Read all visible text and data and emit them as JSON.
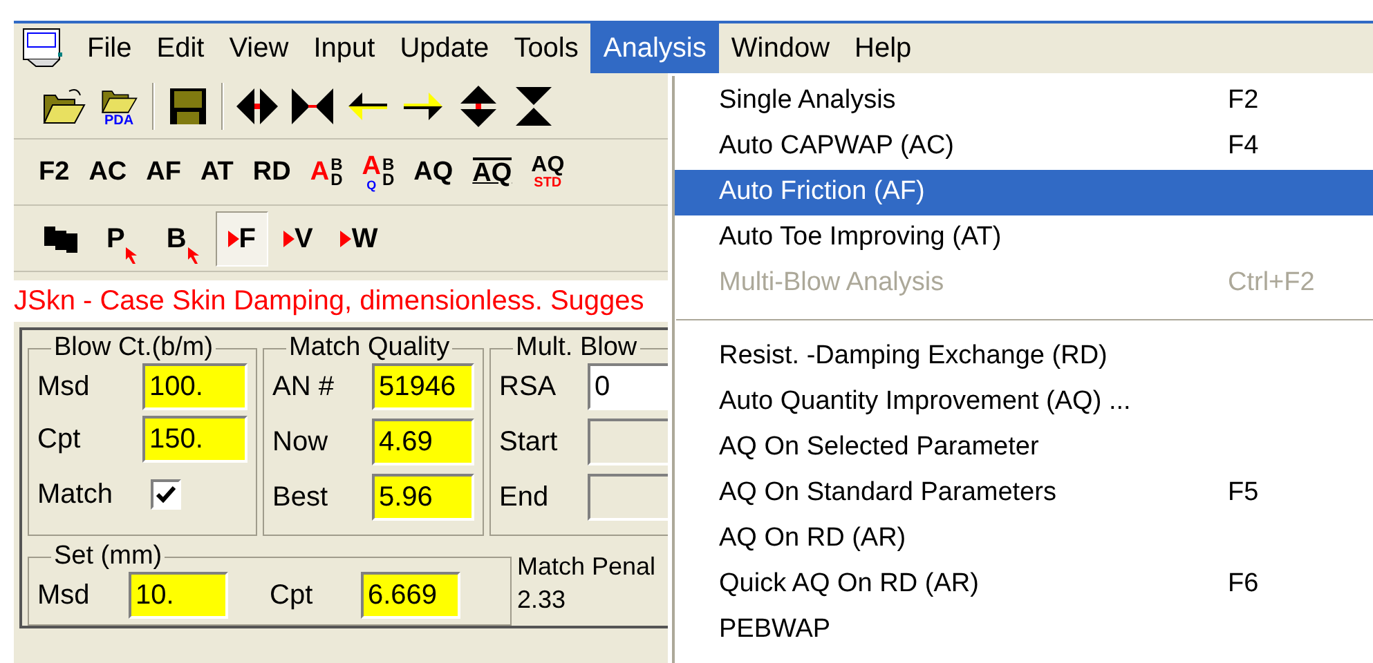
{
  "menu_bar": [
    {
      "label": "File",
      "selected": false
    },
    {
      "label": "Edit",
      "selected": false
    },
    {
      "label": "View",
      "selected": false
    },
    {
      "label": "Input",
      "selected": false
    },
    {
      "label": "Update",
      "selected": false
    },
    {
      "label": "Tools",
      "selected": false
    },
    {
      "label": "Analysis",
      "selected": true
    },
    {
      "label": "Window",
      "selected": false
    },
    {
      "label": "Help",
      "selected": false
    }
  ],
  "toolbar_1": [
    {
      "kind": "open"
    },
    {
      "kind": "open_pda",
      "label": "PDA"
    },
    {
      "kind": "sep"
    },
    {
      "kind": "save"
    },
    {
      "kind": "sep"
    },
    {
      "kind": "spread_h"
    },
    {
      "kind": "squeeze_h"
    },
    {
      "kind": "left"
    },
    {
      "kind": "right"
    },
    {
      "kind": "spread_v"
    },
    {
      "kind": "squeeze_v"
    }
  ],
  "toolbar_2": [
    {
      "kind": "text",
      "label": "F2"
    },
    {
      "kind": "text",
      "label": "AC"
    },
    {
      "kind": "text",
      "label": "AF"
    },
    {
      "kind": "text",
      "label": "AT"
    },
    {
      "kind": "text",
      "label": "RD"
    },
    {
      "kind": "stack",
      "main": "A",
      "top": "B",
      "bottom": "D"
    },
    {
      "kind": "stack",
      "main": "A",
      "sub": "Q",
      "top": "B",
      "bottom": "D"
    },
    {
      "kind": "text",
      "label": "AQ"
    },
    {
      "kind": "overline",
      "label": "AQ"
    },
    {
      "kind": "std",
      "label": "AQ",
      "sub": "STD"
    }
  ],
  "toolbar_3": [
    {
      "kind": "blocks",
      "selected": false
    },
    {
      "kind": "cursor",
      "label": "P",
      "selected": false
    },
    {
      "kind": "cursor",
      "label": "B",
      "selected": false
    },
    {
      "kind": "play",
      "label": "F",
      "selected": true
    },
    {
      "kind": "play",
      "label": "V",
      "selected": false
    },
    {
      "kind": "play",
      "label": "W",
      "selected": false
    }
  ],
  "hint": "JSkn - Case Skin Damping, dimensionless. Sugges",
  "blow_count": {
    "title": "Blow Ct.(b/m)",
    "rows": [
      {
        "label": "Msd",
        "value": "100."
      },
      {
        "label": "Cpt",
        "value": "150."
      }
    ],
    "match": {
      "label": "Match",
      "checked": true
    }
  },
  "match_quality": {
    "title": "Match Quality",
    "rows": [
      {
        "label": "AN #",
        "value": "51946"
      },
      {
        "label": "Now",
        "value": "4.69"
      },
      {
        "label": "Best",
        "value": "5.96"
      }
    ]
  },
  "mult_blow": {
    "title": "Mult. Blow",
    "rows": [
      {
        "label": "RSA",
        "value": "0",
        "disabled": false
      },
      {
        "label": "Start",
        "value": "",
        "disabled": true
      },
      {
        "label": "End",
        "value": "",
        "disabled": true
      }
    ]
  },
  "set": {
    "title": "Set (mm)",
    "rows": [
      {
        "label": "Msd",
        "value": "10."
      },
      {
        "label": "Cpt",
        "value": "6.669"
      }
    ]
  },
  "match_penalty": {
    "label": "Match Penal",
    "value": "2.33"
  },
  "analysis_menu": [
    {
      "kind": "item",
      "label": "Single Analysis",
      "shortcut": "F2",
      "selected": false,
      "disabled": false
    },
    {
      "kind": "item",
      "label": "Auto CAPWAP (AC)",
      "shortcut": "F4",
      "selected": false,
      "disabled": false
    },
    {
      "kind": "item",
      "label": "Auto Friction (AF)",
      "selected": true,
      "disabled": false
    },
    {
      "kind": "item",
      "label": "Auto Toe Improving (AT)",
      "selected": false,
      "disabled": false
    },
    {
      "kind": "item",
      "label": "Multi-Blow Analysis",
      "shortcut": "Ctrl+F2",
      "selected": false,
      "disabled": true
    },
    {
      "kind": "separator"
    },
    {
      "kind": "item",
      "label": "Resist. -Damping Exchange (RD)",
      "selected": false,
      "disabled": false
    },
    {
      "kind": "item",
      "label": "Auto Quantity Improvement (AQ) ...",
      "selected": false,
      "disabled": false
    },
    {
      "kind": "item",
      "label": "AQ On Selected Parameter",
      "selected": false,
      "disabled": false
    },
    {
      "kind": "item",
      "label": "AQ On Standard Parameters",
      "shortcut": "F5",
      "selected": false,
      "disabled": false
    },
    {
      "kind": "item",
      "label": "AQ On RD (AR)",
      "selected": false,
      "disabled": false
    },
    {
      "kind": "item",
      "label": "Quick AQ On RD (AR)",
      "shortcut": "F6",
      "selected": false,
      "disabled": false
    },
    {
      "kind": "item",
      "label": "PEBWAP",
      "selected": false,
      "disabled": false
    }
  ]
}
